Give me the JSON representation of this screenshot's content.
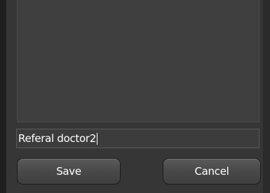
{
  "form": {
    "field_value": "Referal doctor2"
  },
  "buttons": {
    "save_label": "Save",
    "cancel_label": "Cancel"
  }
}
